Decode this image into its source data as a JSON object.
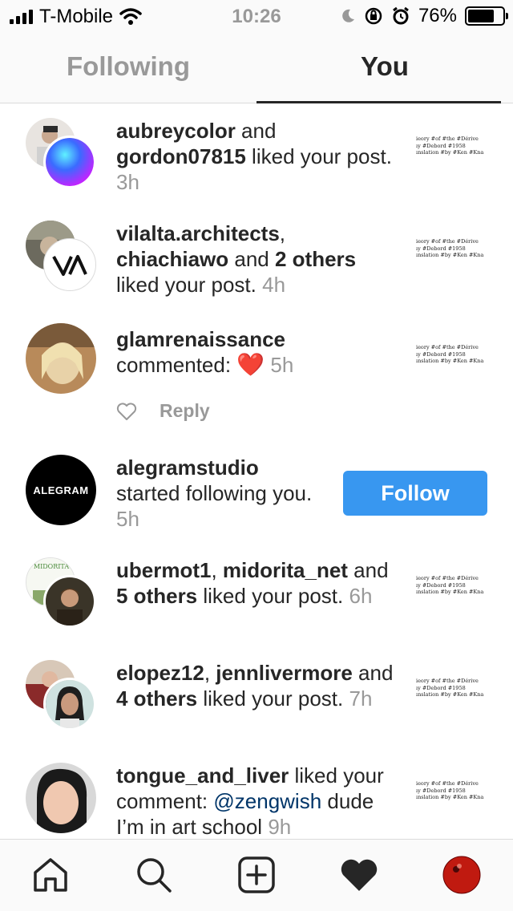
{
  "status_bar": {
    "carrier": "T-Mobile",
    "time": "10:26",
    "battery": "76%",
    "battery_level": 0.76
  },
  "tabs": [
    {
      "label": "Following",
      "active": false
    },
    {
      "label": "You",
      "active": true
    }
  ],
  "thumbnail_text": [
    "ieory #of #the #Dérive",
    "ıy #Debord #1958",
    "ınslation #by #Ken #Kna"
  ],
  "notifications": [
    {
      "parts": [
        {
          "t": "aubreycolor",
          "b": true
        },
        {
          "t": " and ",
          "b": false
        },
        {
          "t": "gordon07815",
          "b": true
        },
        {
          "t": " liked your post.",
          "b": false
        }
      ],
      "time": "3h"
    },
    {
      "parts": [
        {
          "t": "vilalta.architects",
          "b": true
        },
        {
          "t": ", ",
          "b": false
        },
        {
          "t": "chiachiawo",
          "b": true
        },
        {
          "t": " and ",
          "b": false
        },
        {
          "t": "2 others",
          "b": true
        },
        {
          "t": " liked your post.",
          "b": false
        }
      ],
      "time": "4h"
    },
    {
      "parts": [
        {
          "t": "glamrenaissance",
          "b": true
        },
        {
          "t": " commented: ",
          "b": false
        }
      ],
      "emoji": "❤️",
      "time": "5h",
      "reply_label": "Reply"
    },
    {
      "parts": [
        {
          "t": "alegramstudio",
          "b": true
        },
        {
          "t": " started following you.",
          "b": false
        }
      ],
      "time": "5h",
      "avatar_text": "ALEGRAM",
      "button": "Follow"
    },
    {
      "parts": [
        {
          "t": "ubermot1",
          "b": true
        },
        {
          "t": ", ",
          "b": false
        },
        {
          "t": "midorita_net",
          "b": true
        },
        {
          "t": " and ",
          "b": false
        },
        {
          "t": "5 others",
          "b": true
        },
        {
          "t": " liked your post.",
          "b": false
        }
      ],
      "time": "6h",
      "avatar_text": "MIDORITA"
    },
    {
      "parts": [
        {
          "t": "elopez12",
          "b": true
        },
        {
          "t": ", ",
          "b": false
        },
        {
          "t": "jennlivermore",
          "b": true
        },
        {
          "t": " and ",
          "b": false
        },
        {
          "t": "4 others",
          "b": true
        },
        {
          "t": " liked your post.",
          "b": false
        }
      ],
      "time": "7h"
    },
    {
      "parts": [
        {
          "t": "tongue_and_liver",
          "b": true
        },
        {
          "t": " liked your comment: ",
          "b": false
        },
        {
          "t": "@zengwish",
          "b": false,
          "m": true
        },
        {
          "t": " dude I’m in art school",
          "b": false
        }
      ],
      "time": "9h"
    }
  ],
  "nav": [
    "home-icon",
    "search-icon",
    "new-post-icon",
    "activity-heart-icon",
    "profile-avatar"
  ],
  "colors": {
    "accent": "#3897f0",
    "secondary_text": "#999999",
    "mention": "#003569"
  }
}
